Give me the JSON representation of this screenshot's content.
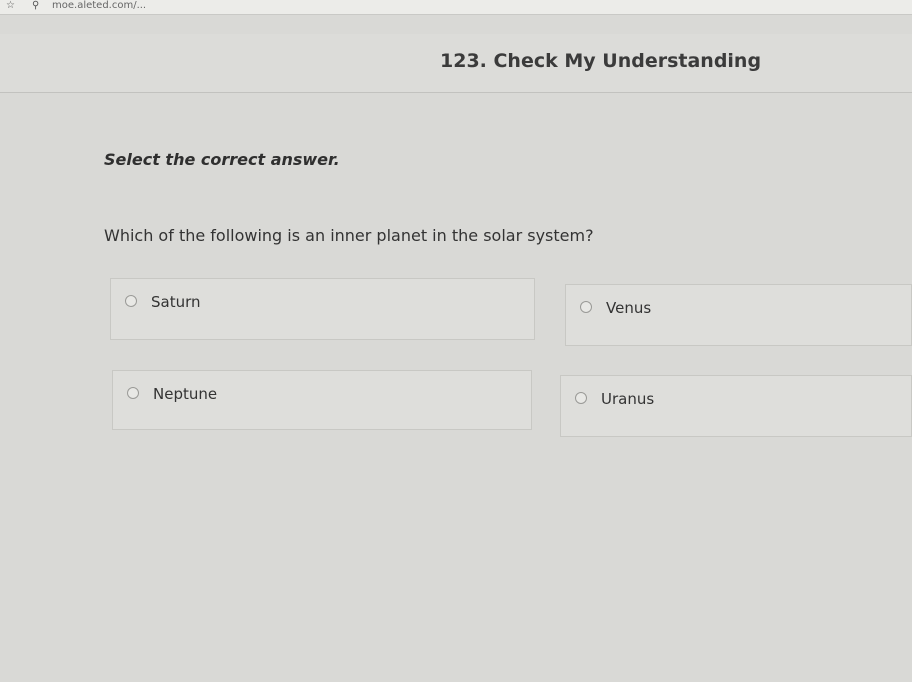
{
  "browser": {
    "url": "moe.aleted.com/..."
  },
  "header": {
    "title": "123. Check My Understanding"
  },
  "question": {
    "instruction": "Select the correct answer.",
    "prompt": "Which of the following is an inner planet in the solar system?",
    "choices": [
      {
        "label": "Saturn",
        "selected": false
      },
      {
        "label": "Venus",
        "selected": false
      },
      {
        "label": "Neptune",
        "selected": false
      },
      {
        "label": "Uranus",
        "selected": false
      }
    ]
  },
  "colors": {
    "background": "#d9d9d6",
    "text": "#333333"
  }
}
